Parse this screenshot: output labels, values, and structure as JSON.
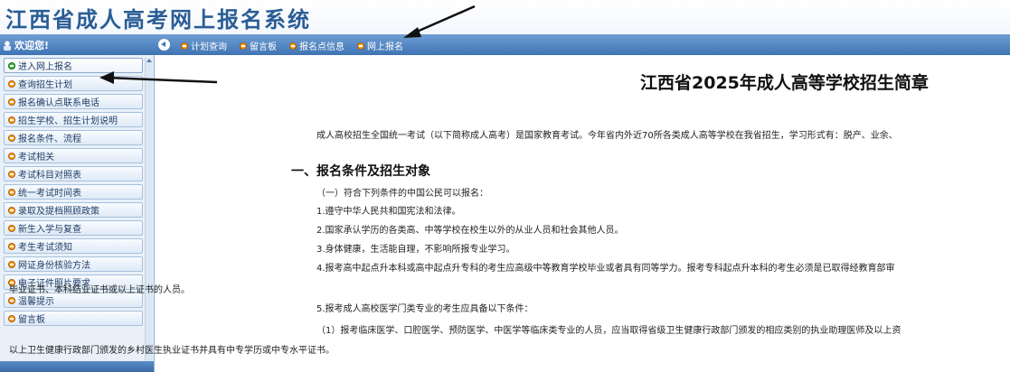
{
  "header": {
    "site_title": "江西省成人高考网上报名系统"
  },
  "navbar": {
    "welcome": "欢迎您!",
    "links": [
      "计划查询",
      "留言板",
      "报名点信息",
      "网上报名"
    ]
  },
  "sidebar": {
    "items": [
      "进入网上报名",
      "查询招生计划",
      "报名确认点联系电话",
      "招生学校、招生计划说明",
      "报名条件、流程",
      "考试相关",
      "考试科目对照表",
      "统一考试时间表",
      "录取及提档照顾政策",
      "新生入学与复查",
      "考生考试须知",
      "网证身份核验方法",
      "电子证件照片要求",
      "温馨提示",
      "留言板"
    ],
    "active_index": 0
  },
  "content": {
    "title": "江西省2025年成人高等学校招生简章",
    "intro": "成人高校招生全国统一考试（以下简称成人高考）是国家教育考试。今年省内外近70所各类成人高等学校在我省招生，学习形式有：脱产、业余、",
    "section1_title": "一、报名条件及招生对象",
    "lines": [
      "（一）符合下列条件的中国公民可以报名：",
      "1.遵守中华人民共和国宪法和法律。",
      "2.国家承认学历的各类高、中等学校在校生以外的从业人员和社会其他人员。",
      "3.身体健康，生活能自理，不影响所报专业学习。",
      "4.报考高中起点升本科或高中起点升专科的考生应高级中等教育学校毕业或者具有同等学力。报考专科起点升本科的考生必须是已取得经教育部审",
      "毕业证书、本科结业证书或以上证书的人员。",
      "5.报考成人高校医学门类专业的考生应具备以下条件：",
      "（1）报考临床医学、口腔医学、预防医学、中医学等临床类专业的人员，应当取得省级卫生健康行政部门颁发的相应类别的执业助理医师及以上资",
      "以上卫生健康行政部门颁发的乡村医生执业证书并具有中专学历或中专水平证书。"
    ]
  },
  "colors": {
    "title_blue": "#2a5d95",
    "nav_top": "#6f9fd4",
    "nav_bottom": "#3f73b3",
    "sidebar_bg": "#e9f0f8",
    "bullet_orange": "#f7a21b",
    "bullet_green": "#3dbb3d"
  },
  "icons": {
    "welcome": "user-icon",
    "collapse": "collapse-left-icon",
    "bullet": "orange-circle-bullet-icon",
    "active_bullet": "green-circle-bullet-icon"
  }
}
